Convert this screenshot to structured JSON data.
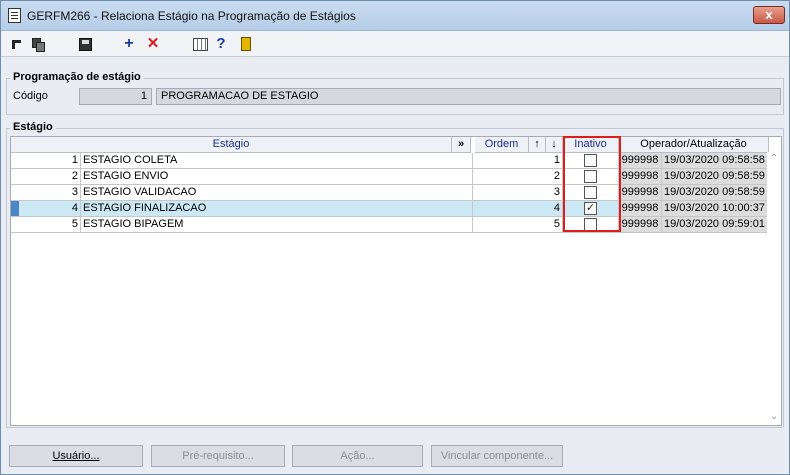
{
  "window": {
    "title": "GERFM266 - Relaciona Estágio na Programação de Estágios",
    "close_label": "x"
  },
  "toolbar": {
    "icons": [
      "arrow-icon",
      "copy-icon",
      "save-icon",
      "add-icon",
      "delete-icon",
      "grid-icon",
      "help-icon",
      "exit-icon"
    ],
    "add_glyph": "+",
    "delete_glyph": "✕",
    "help_glyph": "?"
  },
  "programacao": {
    "group_title": "Programação de estágio",
    "codigo_label": "Código",
    "codigo_value": "1",
    "nome_value": "PROGRAMACAO DE ESTAGIO"
  },
  "estagio": {
    "group_title": "Estágio",
    "columns": {
      "estagio": "Estágio",
      "expand": "»",
      "ordem": "Ordem",
      "up": "↑",
      "down": "↓",
      "inativo": "Inativo",
      "operador": "Operador/Atualização"
    },
    "rows": [
      {
        "num": "1",
        "nome": "ESTAGIO COLETA",
        "ordem": "1",
        "inativo": false,
        "check": "",
        "operador": "999998",
        "data": "19/03/2020 09:58:58"
      },
      {
        "num": "2",
        "nome": "ESTAGIO ENVIO",
        "ordem": "2",
        "inativo": false,
        "check": "",
        "operador": "999998",
        "data": "19/03/2020 09:58:59"
      },
      {
        "num": "3",
        "nome": "ESTAGIO VALIDACAO",
        "ordem": "3",
        "inativo": false,
        "check": "",
        "operador": "999998",
        "data": "19/03/2020 09:58:59"
      },
      {
        "num": "4",
        "nome": "ESTAGIO FINALIZACAO",
        "ordem": "4",
        "inativo": true,
        "check": "✓",
        "operador": "999998",
        "data": "19/03/2020 10:00:37"
      },
      {
        "num": "5",
        "nome": "ESTAGIO BIPAGEM",
        "ordem": "5",
        "inativo": false,
        "check": "",
        "operador": "999998",
        "data": "19/03/2020 09:59:01"
      }
    ],
    "selected_row": 3
  },
  "buttons": {
    "usuario": "Usuário...",
    "prereq": "Pré-requisito...",
    "acao": "Ação...",
    "vincular": "Vincular componente..."
  },
  "colors": {
    "highlight_box": "#e01b1b",
    "selected_row": "#cde8f5",
    "header_text": "#1c2f8f"
  }
}
